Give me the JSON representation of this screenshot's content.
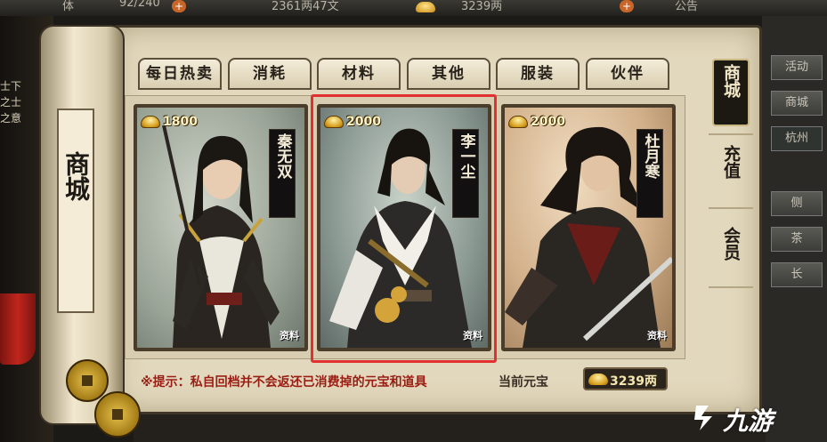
{
  "topbar": {
    "stamina": "92/240",
    "money": "2361两47文",
    "ingots": "3239两",
    "notice": "公告",
    "left_text": "体"
  },
  "left_side": {
    "line1": "士下",
    "line2": "之士",
    "line3": "之意"
  },
  "scroll": {
    "title": "商城"
  },
  "tabs": [
    {
      "label": "每日热卖"
    },
    {
      "label": "消耗"
    },
    {
      "label": "材料"
    },
    {
      "label": "其他"
    },
    {
      "label": "服装"
    },
    {
      "label": "伙伴"
    }
  ],
  "side_tabs": {
    "shop": "商城",
    "recharge": "充值",
    "member": "会员"
  },
  "right_panel": {
    "btn1": "活动",
    "btn2": "商城",
    "location": "杭州",
    "item1": "侧",
    "item2": "茶",
    "item3": "长"
  },
  "cards": [
    {
      "name": "秦无双",
      "price": "1800",
      "tag": "资料"
    },
    {
      "name": "李一尘",
      "price": "2000",
      "tag": "资料"
    },
    {
      "name": "杜月寒",
      "price": "2000",
      "tag": "资料"
    }
  ],
  "footer": {
    "tip": "※提示：私自回档并不会返还已消费掉的元宝和道具",
    "current_label": "当前元宝",
    "current_value": "3239两"
  },
  "watermark": "九游",
  "colors": {
    "highlight": "#e23030",
    "tip": "#9a1d13",
    "panel": "#e2d8bd"
  }
}
